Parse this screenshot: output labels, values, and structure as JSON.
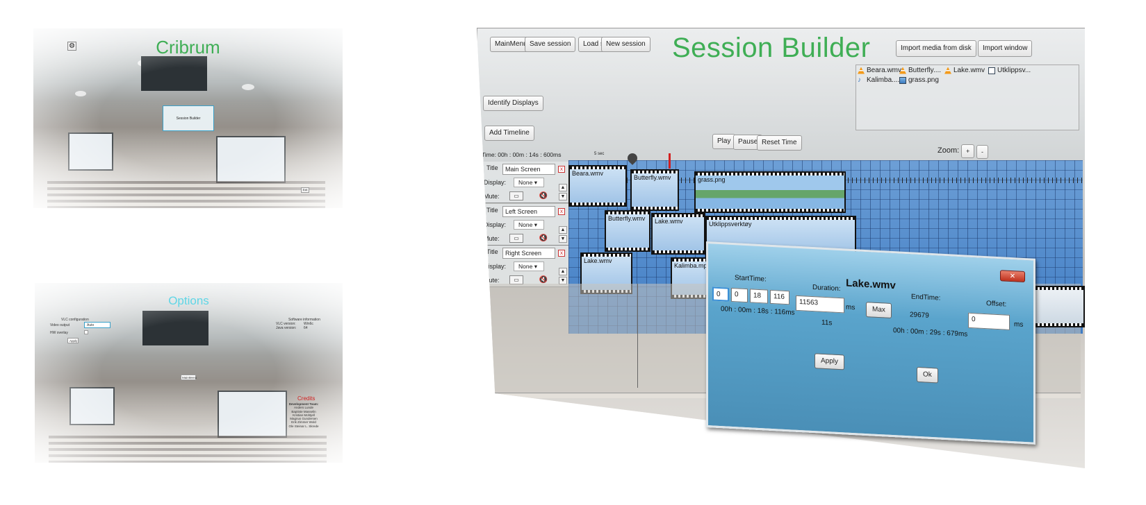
{
  "main_menu": {
    "title": "Cribrum",
    "settings_icon": "gear-icon",
    "session_builder_button": "Session Builder",
    "exit_button": "Exit"
  },
  "options": {
    "title": "Options",
    "vlc_config_label": "VLC configuration",
    "video_output_label": "Video output",
    "video_output_value": "Auto",
    "hw_overlay_label": "HW overlay",
    "apply_button": "Apply",
    "software_info_label": "Software information",
    "vlc_version_label": "VLC version:",
    "vlc_version_value": "Win6c",
    "java_version_label": "Java version:",
    "java_version_value": "64",
    "mainmenu_button": "MainMenu",
    "credits_title": "Credits",
    "credits": [
      "Development Team:",
      "Anders Lunde",
      "Baptiste Masselin",
      "Kristian Mohtjell",
      "Magnus Gundersen",
      "Erik Zimmer Wold",
      "Ole Steinar L. Skrede"
    ]
  },
  "session_builder": {
    "title": "Session Builder",
    "toolbar": {
      "mainmenu": "MainMenu",
      "save": "Save session",
      "load": "Load session",
      "new": "New session",
      "import_disk": "Import media from disk",
      "import_window": "Import window",
      "identify_displays": "Identify Displays",
      "add_timeline": "Add Timeline",
      "play": "Play",
      "pause": "Pause",
      "reset_time": "Reset Time",
      "zoom_label": "Zoom:",
      "zoom_in": "+",
      "zoom_out": "-"
    },
    "media": [
      {
        "name": "Beara.wmv",
        "icon": "vlc-icon"
      },
      {
        "name": "Butterfly....",
        "icon": "vlc-icon"
      },
      {
        "name": "Lake.wmv",
        "icon": "vlc-icon"
      },
      {
        "name": "Utklippsv...",
        "icon": "document-icon"
      },
      {
        "name": "Kalimba....",
        "icon": "music-icon"
      },
      {
        "name": "grass.png",
        "icon": "image-icon"
      }
    ],
    "time_readout": "Time: 00h : 00m : 14s : 600ms",
    "ruler_label": "5 sec",
    "tracks": [
      {
        "title_label": "Title",
        "title": "Main Screen",
        "display_label": "Display:",
        "display": "None",
        "mute_label": "Mute:",
        "clips": [
          "Beara.wmv",
          "Butterfly.wmv",
          "grass.png"
        ]
      },
      {
        "title_label": "Title",
        "title": "Left Screen",
        "display_label": "Display:",
        "display": "None",
        "mute_label": "Mute:",
        "clips": [
          "Butterfly.wmv",
          "Lake.wmv",
          "Utklippsverktøy"
        ]
      },
      {
        "title_label": "Title",
        "title": "Right Screen",
        "display_label": "Display:",
        "display": "None",
        "mute_label": "Mute:",
        "clips": [
          "Lake.wmv",
          "Kalimba.mp3"
        ]
      }
    ],
    "remove_glyph": "x",
    "dropdown_glyph": "▾",
    "up_glyph": "▲",
    "down_glyph": "▼"
  },
  "dialog": {
    "title": "Lake.wmv",
    "close": "✕",
    "start_label": "StartTime:",
    "start_fields": [
      "0",
      "0",
      "18",
      "116"
    ],
    "start_text": "00h : 00m : 18s : 116ms",
    "duration_label": "Duration:",
    "duration_value": "11563",
    "duration_unit": "ms",
    "duration_text": "11s",
    "max_button": "Max",
    "end_label": "EndTime:",
    "end_value": "29679",
    "end_text": "00h : 00m : 29s : 679ms",
    "offset_label": "Offset:",
    "offset_value": "0",
    "offset_unit": "ms",
    "apply_button": "Apply",
    "ok_button": "Ok"
  }
}
